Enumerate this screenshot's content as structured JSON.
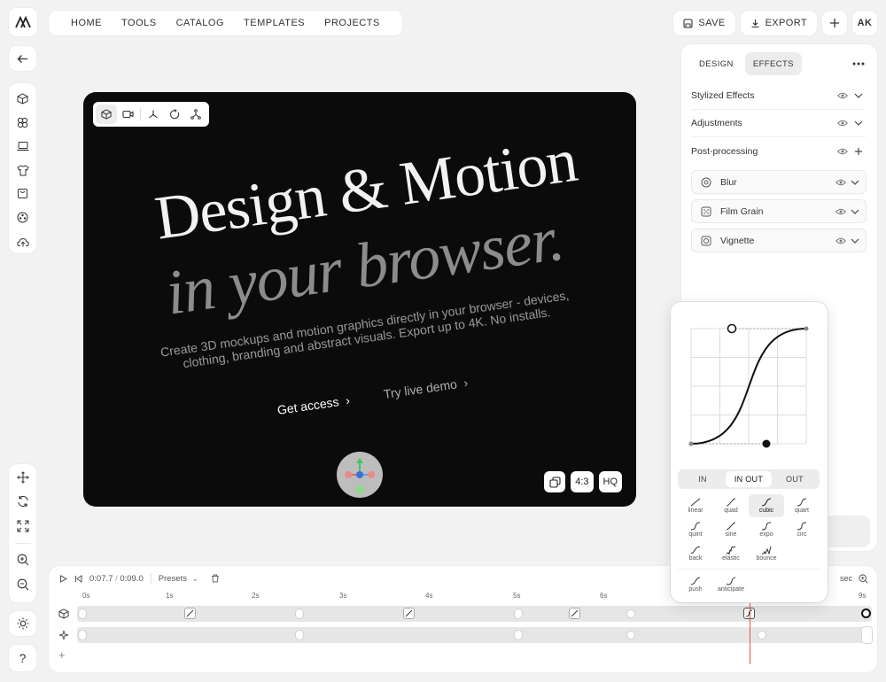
{
  "app": {
    "logo_label": "logo-mark"
  },
  "topnav": {
    "items": [
      "HOME",
      "TOOLS",
      "CATALOG",
      "TEMPLATES",
      "PROJECTS"
    ]
  },
  "toolbar": {
    "save_label": "SAVE",
    "export_label": "EXPORT",
    "avatar_initials": "AK"
  },
  "canvas": {
    "headline": "Design & Motion",
    "headline_italic": "in your browser.",
    "subtitle": "Create 3D mockups and motion graphics directly in your browser - devices, clothing, branding and abstract visuals. Export up to 4K. No installs.",
    "cta_primary": "Get access",
    "cta_secondary": "Try live demo",
    "aspect_label": "4:3",
    "quality_label": "HQ"
  },
  "panel": {
    "tabs": [
      "DESIGN",
      "EFFECTS"
    ],
    "active_tab": "EFFECTS",
    "sections": [
      "Stylized Effects",
      "Adjustments",
      "Post-processing"
    ],
    "effects": [
      "Blur",
      "Film Grain",
      "Vignette"
    ]
  },
  "easing": {
    "modes": [
      "IN",
      "IN OUT",
      "OUT"
    ],
    "active_mode": "IN OUT",
    "types": [
      "linear",
      "quad",
      "cubic",
      "quart",
      "quint",
      "sine",
      "expo",
      "circ",
      "back",
      "elastic",
      "bounce"
    ],
    "extra_types": [
      "push",
      "anticipate"
    ],
    "active_type": "cubic"
  },
  "timeline": {
    "current_time": "0:07.7",
    "separator": "/",
    "total_time": "0:09.0",
    "presets_label": "Presets",
    "unit_label": "sec",
    "ticks": [
      "0s",
      "1s",
      "2s",
      "3s",
      "4s",
      "5s",
      "6s",
      "7s",
      "8s",
      "9s"
    ],
    "add_label": "+"
  },
  "help_label": "?"
}
